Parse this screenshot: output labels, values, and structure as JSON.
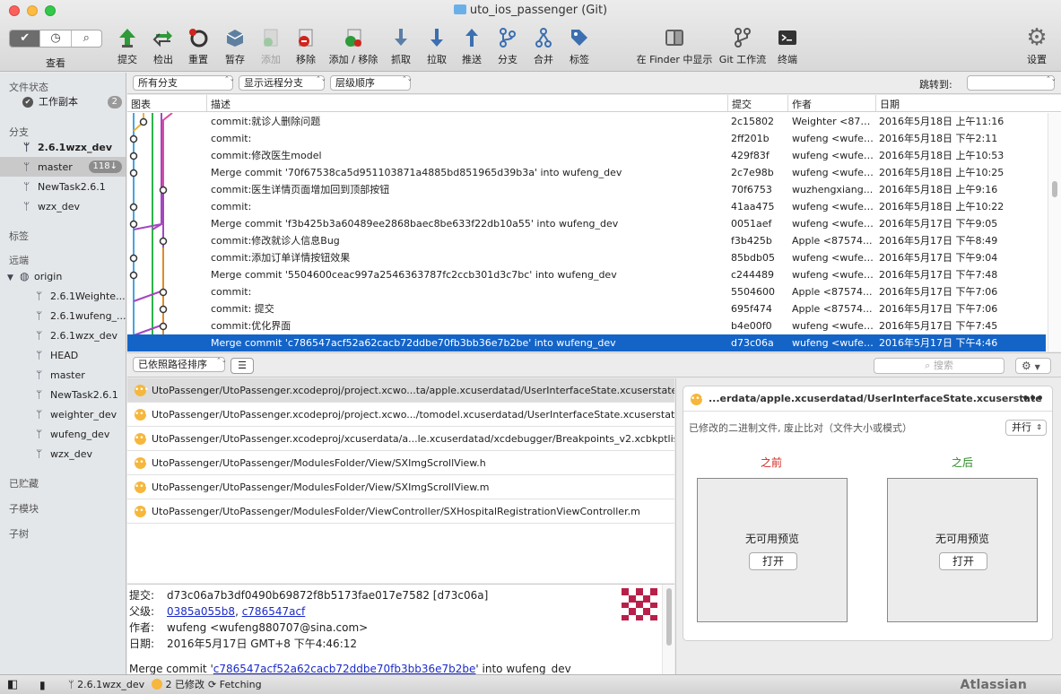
{
  "window": {
    "title": "uto_ios_passenger (Git)"
  },
  "toolbar": {
    "view_label": "查看",
    "buttons": [
      {
        "label": "提交",
        "icon": "commit-icon"
      },
      {
        "label": "检出",
        "icon": "checkout-icon"
      },
      {
        "label": "重置",
        "icon": "reset-icon"
      },
      {
        "label": "暂存",
        "icon": "stash-icon"
      },
      {
        "label": "添加",
        "icon": "add-icon"
      },
      {
        "label": "移除",
        "icon": "remove-icon"
      },
      {
        "label": "添加 / 移除",
        "icon": "add-remove-icon"
      },
      {
        "label": "抓取",
        "icon": "fetch-icon"
      },
      {
        "label": "拉取",
        "icon": "pull-icon"
      },
      {
        "label": "推送",
        "icon": "push-icon"
      },
      {
        "label": "分支",
        "icon": "branch-icon"
      },
      {
        "label": "合并",
        "icon": "merge-icon"
      },
      {
        "label": "标签",
        "icon": "tag-icon"
      },
      {
        "label": "在 Finder 中显示",
        "icon": "finder-icon"
      },
      {
        "label": "Git 工作流",
        "icon": "git-flow-icon"
      },
      {
        "label": "终端",
        "icon": "terminal-icon"
      },
      {
        "label": "设置",
        "icon": "settings-gear-icon"
      }
    ]
  },
  "sidebar": {
    "file_status": "文件状态",
    "working_copy": "工作副本",
    "working_copy_count": "2",
    "branches_header": "分支",
    "branches": [
      "2.6.1wzx_dev",
      "master",
      "NewTask2.6.1",
      "wzx_dev"
    ],
    "master_badge": "118↓",
    "tags_header": "标签",
    "remotes_header": "远端",
    "origin": "origin",
    "remote_branches": [
      "2.6.1Weighte...",
      "2.6.1wufeng_...",
      "2.6.1wzx_dev",
      "HEAD",
      "master",
      "NewTask2.6.1",
      "weighter_dev",
      "wufeng_dev",
      "wzx_dev"
    ],
    "stashes": "已贮藏",
    "submodules": "子模块",
    "subtrees": "子树"
  },
  "filter": {
    "branches": "所有分支",
    "remote": "显示远程分支",
    "order": "层级顺序",
    "jump_label": "跳转到:"
  },
  "columns": {
    "graph": "图表",
    "desc": "描述",
    "commit": "提交",
    "author": "作者",
    "date": "日期"
  },
  "commits": [
    {
      "desc": "commit:就诊人删除问题",
      "hash": "2c15802",
      "author": "Weighter <875...",
      "date": "2016年5月18日 上午11:16"
    },
    {
      "desc": "commit:",
      "hash": "2ff201b",
      "author": "wufeng <wufen...",
      "date": "2016年5月18日 下午2:11"
    },
    {
      "desc": "commit:修改医生model",
      "hash": "429f83f",
      "author": "wufeng <wufen...",
      "date": "2016年5月18日 上午10:53"
    },
    {
      "desc": "Merge commit '70f67538ca5d951103871a4885bd851965d39b3a' into wufeng_dev",
      "hash": "2c7e98b",
      "author": "wufeng <wufen...",
      "date": "2016年5月18日 上午10:25"
    },
    {
      "desc": "commit:医生详情页面增加回到顶部按钮",
      "hash": "70f6753",
      "author": "wuzhengxiang...",
      "date": "2016年5月18日 上午9:16"
    },
    {
      "desc": "commit:",
      "hash": "41aa475",
      "author": "wufeng <wufen...",
      "date": "2016年5月18日 上午10:22"
    },
    {
      "desc": "Merge commit 'f3b425b3a60489ee2868baec8be633f22db10a55' into wufeng_dev",
      "hash": "0051aef",
      "author": "wufeng <wufen...",
      "date": "2016年5月17日 下午9:05"
    },
    {
      "desc": "commit:修改就诊人信息Bug",
      "hash": "f3b425b",
      "author": "Apple <87574...",
      "date": "2016年5月17日 下午8:49"
    },
    {
      "desc": "commit:添加订单详情按钮效果",
      "hash": "85bdb05",
      "author": "wufeng <wufen...",
      "date": "2016年5月17日 下午9:04"
    },
    {
      "desc": "Merge commit '5504600ceac997a2546363787fc2ccb301d3c7bc' into wufeng_dev",
      "hash": "c244489",
      "author": "wufeng <wufen...",
      "date": "2016年5月17日 下午7:48"
    },
    {
      "desc": "commit:",
      "hash": "5504600",
      "author": "Apple <87574...",
      "date": "2016年5月17日 下午7:06"
    },
    {
      "desc": "commit:  提交",
      "hash": "695f474",
      "author": "Apple <87574...",
      "date": "2016年5月17日 下午7:06"
    },
    {
      "desc": "commit:优化界面",
      "hash": "b4e00f0",
      "author": "wufeng <wufen...",
      "date": "2016年5月17日 下午7:45"
    },
    {
      "desc": "Merge commit 'c786547acf52a62cacb72ddbe70fb3bb36e7b2be' into wufeng_dev",
      "hash": "d73c06a",
      "author": "wufeng <wufen...",
      "date": "2016年5月17日 下午4:46"
    }
  ],
  "midbar": {
    "sort": "已依照路径排序",
    "search_placeholder": "搜索"
  },
  "files": [
    "UtoPassenger/UtoPassenger.xcodeproj/project.xcwo...ta/apple.xcuserdatad/UserInterfaceState.xcuserstate",
    "UtoPassenger/UtoPassenger.xcodeproj/project.xcwo.../tomodel.xcuserdatad/UserInterfaceState.xcuserstate",
    "UtoPassenger/UtoPassenger.xcodeproj/xcuserdata/a...le.xcuserdatad/xcdebugger/Breakpoints_v2.xcbkptlist",
    "UtoPassenger/UtoPassenger/ModulesFolder/View/SXImgScrollView.h",
    "UtoPassenger/UtoPassenger/ModulesFolder/View/SXImgScrollView.m",
    "UtoPassenger/UtoPassenger/ModulesFolder/ViewController/SXHospitalRegistrationViewController.m"
  ],
  "preview": {
    "file": "...erdata/apple.xcuserdatad/UserInterfaceState.xcuserstate",
    "more": "•••",
    "message": "已修改的二进制文件, 废止比对（文件大小或模式）",
    "mode": "并行",
    "before": "之前",
    "after": "之后",
    "before_color": "#d0241c",
    "after_color": "#2a8a22",
    "no_preview": "无可用预览",
    "open": "打开"
  },
  "details": {
    "commit_label": "提交:",
    "commit_value": "d73c06a7b3df0490b69872f8b5173fae017e7582 [d73c06a]",
    "parents_label": "父级:",
    "parent1": "0385a055b8",
    "parent_sep": ", ",
    "parent2": "c786547acf",
    "author_label": "作者:",
    "author_value": "wufeng <wufeng880707@sina.com>",
    "date_label": "日期:",
    "date_value": "2016年5月17日 GMT+8 下午4:46:12",
    "message_prefix": "Merge commit '",
    "message_link": "c786547acf52a62cacb72ddbe70fb3bb36e7b2be",
    "message_suffix": "' into wufeng_dev"
  },
  "statusbar": {
    "branch": "2.6.1wzx_dev",
    "changes": "2 已修改",
    "fetching": "Fetching",
    "brand": "Atlassian"
  }
}
